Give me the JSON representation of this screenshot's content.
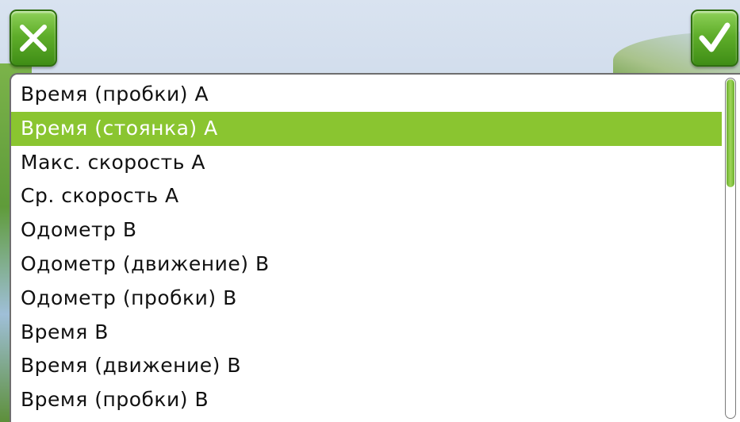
{
  "toolbar": {
    "cancel_icon": "close-x-icon",
    "confirm_icon": "checkmark-icon",
    "accent_color": "#5fae2a"
  },
  "list": {
    "selected_index": 1,
    "selected_color": "#8ac530",
    "items": [
      "Время (пробки) А",
      "Время (стоянка) А",
      "Макс. скорость А",
      "Ср. скорость А",
      "Одометр В",
      "Одометр (движение) В",
      "Одометр (пробки) В",
      "Время В",
      "Время (движение) В",
      "Время (пробки) В"
    ]
  },
  "scroll": {
    "position_fraction": 0.0,
    "visible_fraction": 0.32
  }
}
